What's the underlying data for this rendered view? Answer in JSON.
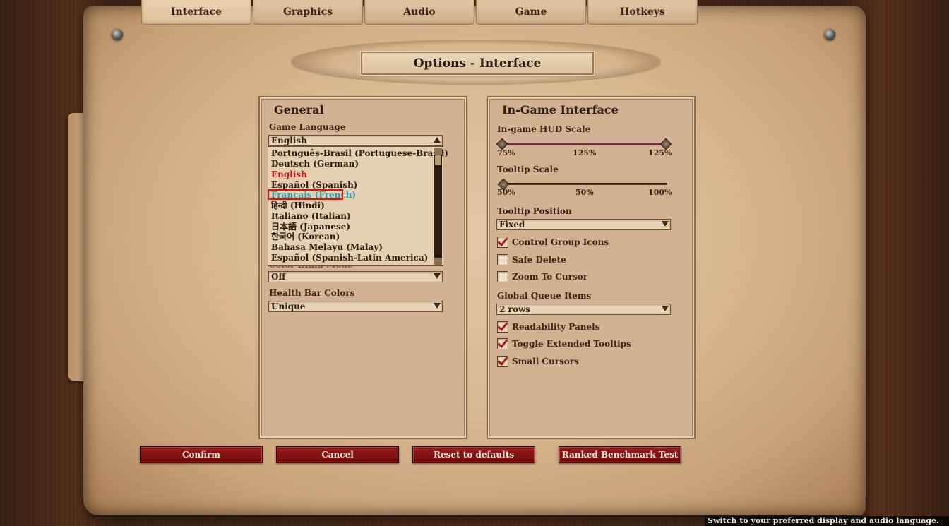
{
  "tabs": [
    {
      "label": "Interface"
    },
    {
      "label": "Graphics"
    },
    {
      "label": "Audio"
    },
    {
      "label": "Game"
    },
    {
      "label": "Hotkeys"
    }
  ],
  "title": "Options - Interface",
  "general": {
    "title": "General",
    "game_language_label": "Game Language",
    "game_language_value": "English",
    "languages": [
      "Português-Brasil (Portuguese-Brasil)",
      "Deutsch (German)",
      "English",
      "Español (Spanish)",
      "Français (French)",
      "हिन्दी (Hindi)",
      "Italiano (Italian)",
      "日本語 (Japanese)",
      "한국어 (Korean)",
      "Bahasa Melayu (Malay)",
      "Español (Spanish-Latin America)"
    ],
    "current_language": "English",
    "hovered_language": "Français (French)",
    "hidden_label_partial": "Color Blind Mode",
    "color_blind_value": "Off",
    "health_bar_label": "Health Bar Colors",
    "health_bar_value": "Unique"
  },
  "ingame": {
    "title": "In-Game Interface",
    "hud_scale_label": "In-game HUD Scale",
    "hud_min": "75%",
    "hud_mid": "125%",
    "hud_value": "125%",
    "hud_fraction": 1.0,
    "tooltip_scale_label": "Tooltip Scale",
    "tooltip_min": "50%",
    "tooltip_value": "50%",
    "tooltip_max": "100%",
    "tooltip_fraction": 0.0,
    "tooltip_position_label": "Tooltip Position",
    "tooltip_position_value": "Fixed",
    "control_group_icons": "Control Group Icons",
    "safe_delete": "Safe Delete",
    "zoom_to_cursor": "Zoom To Cursor",
    "global_queue_label": "Global Queue Items",
    "global_queue_value": "2 rows",
    "readability_panels": "Readability Panels",
    "extended_tooltips": "Toggle Extended Tooltips",
    "small_cursors": "Small Cursors",
    "checks": {
      "control_group_icons": true,
      "safe_delete": false,
      "zoom_to_cursor": false,
      "readability_panels": true,
      "extended_tooltips": true,
      "small_cursors": true
    }
  },
  "buttons": {
    "confirm": "Confirm",
    "cancel": "Cancel",
    "reset": "Reset to defaults",
    "benchmark": "Ranked Benchmark Test"
  },
  "status_tooltip": "Switch to your preferred display and audio language."
}
